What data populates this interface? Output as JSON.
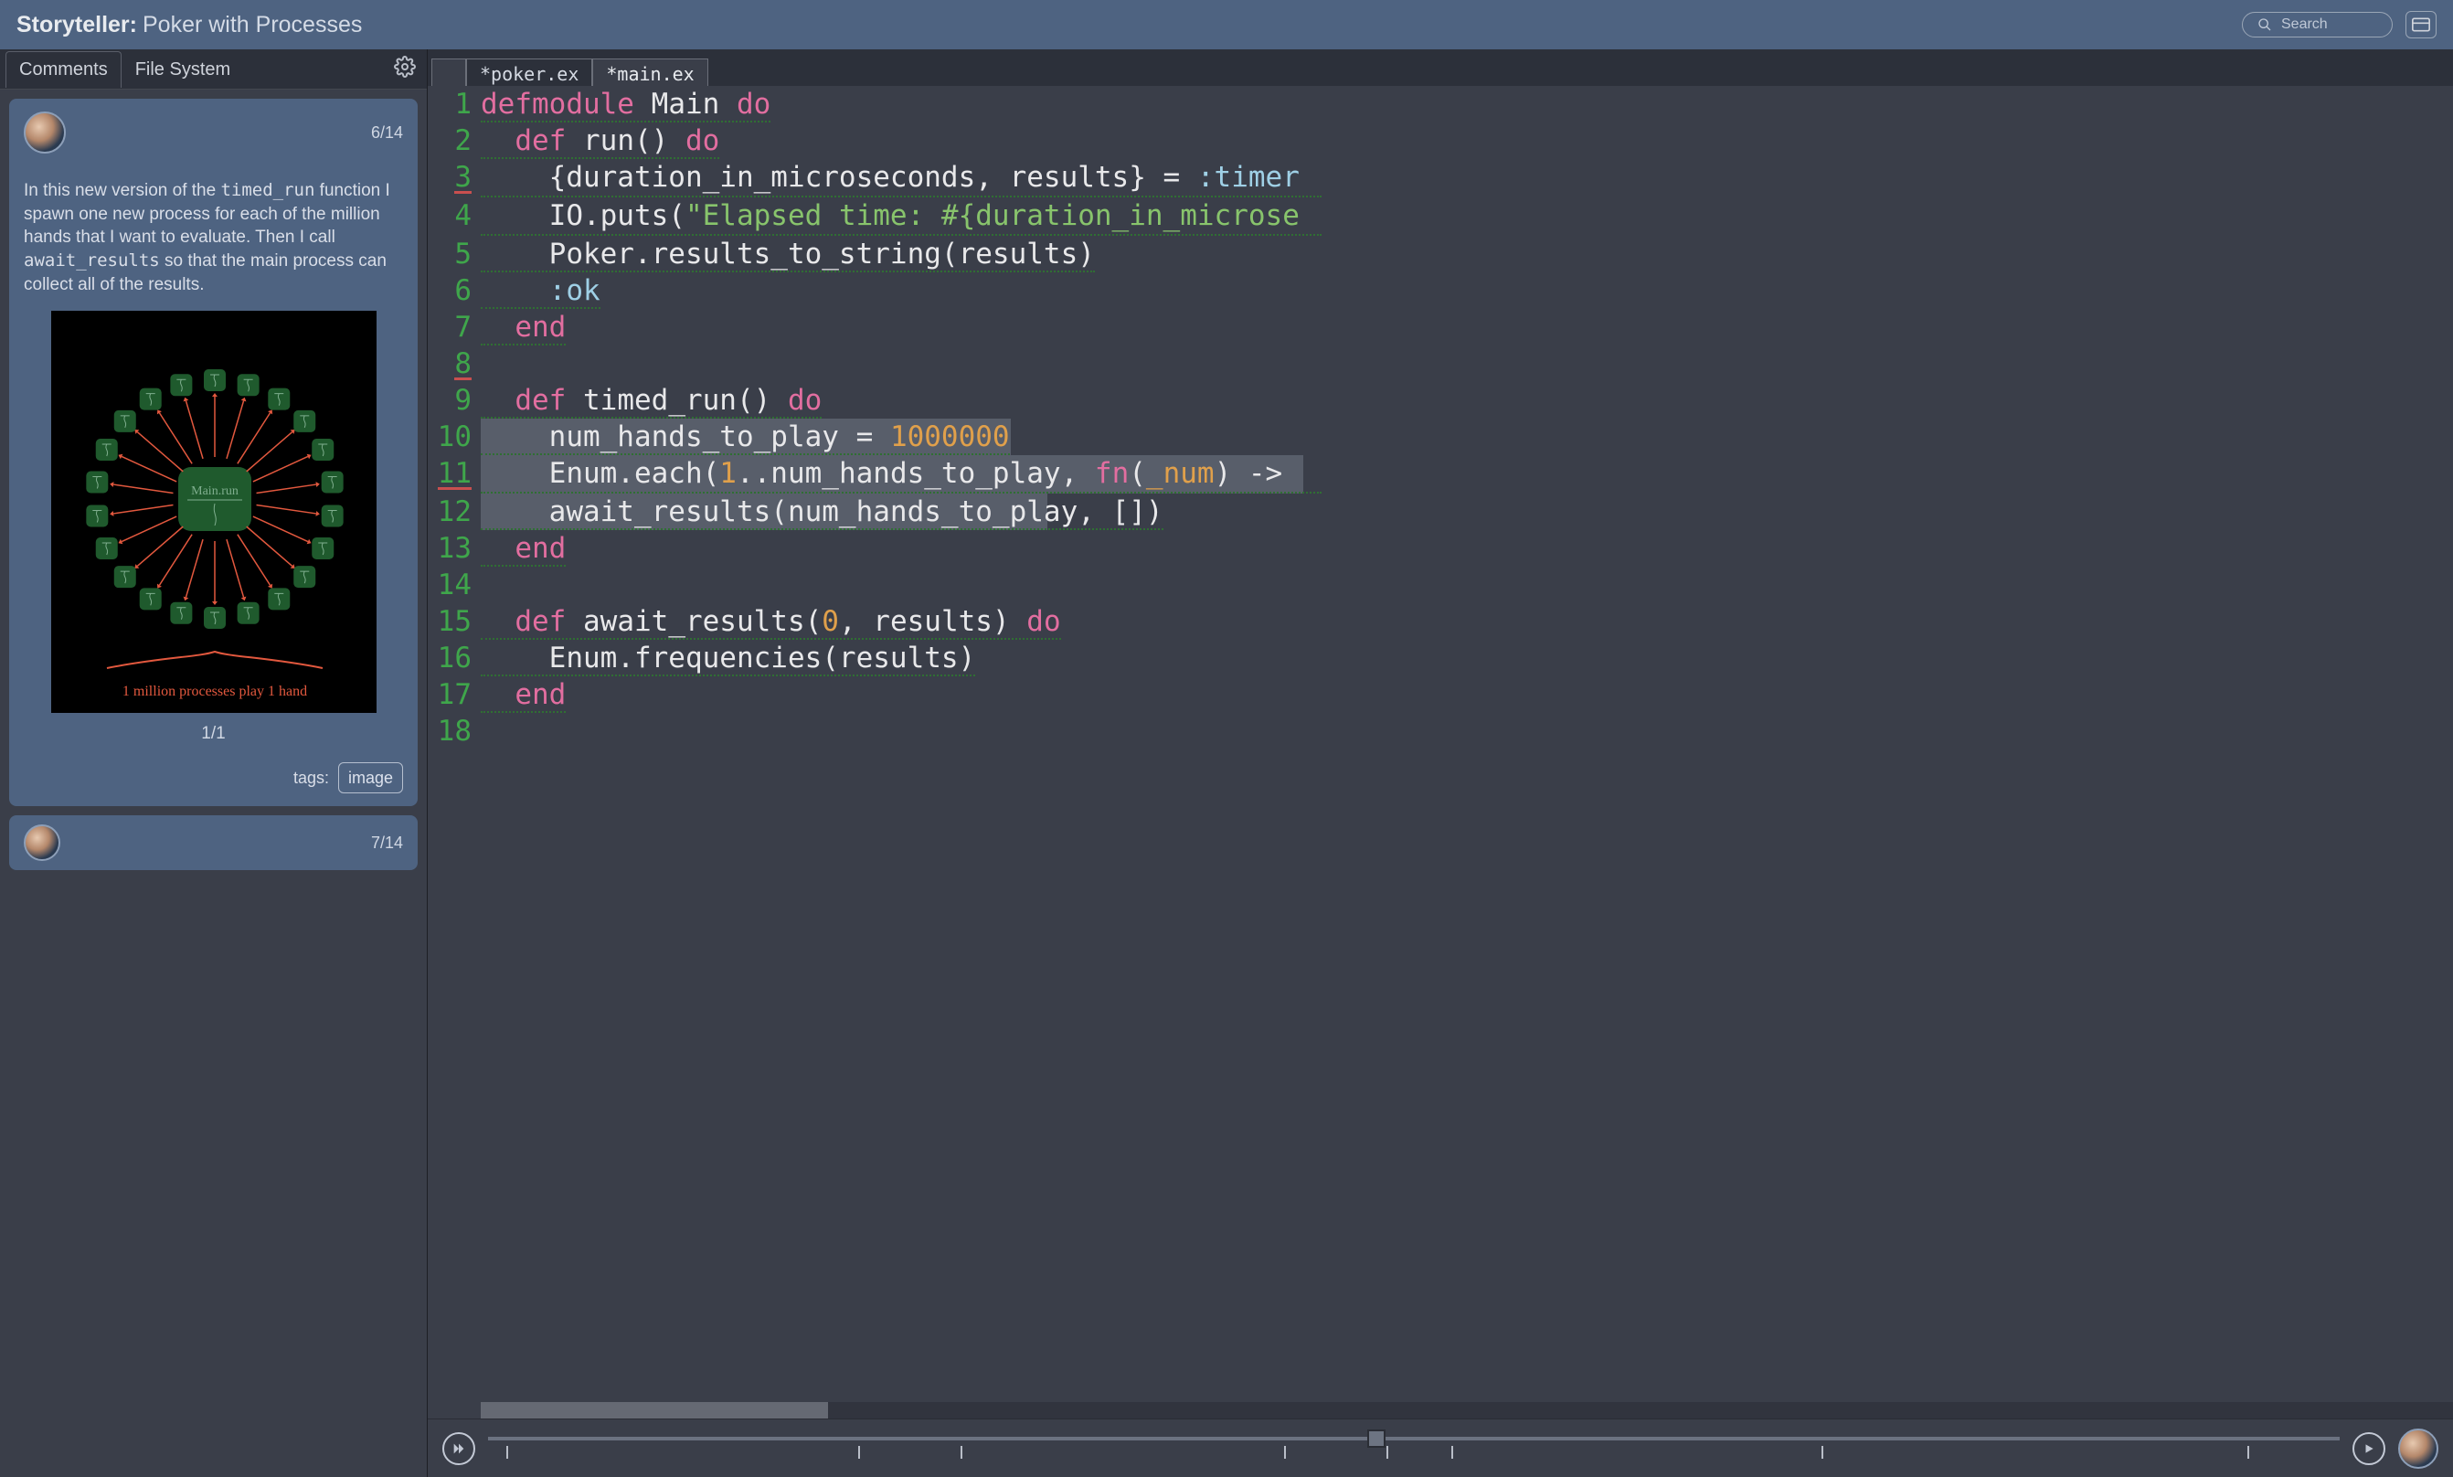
{
  "header": {
    "app_name": "Storyteller:",
    "project_title": "Poker with Processes",
    "search_placeholder": "Search"
  },
  "left_panel": {
    "tabs": {
      "comments": "Comments",
      "filesystem": "File System",
      "active": "comments"
    },
    "comment": {
      "counter": "6/14",
      "body_before_code1": "In this new version of the ",
      "code1": "timed_run",
      "body_mid": " function I spawn one new process for each of the million hands that I want to evaluate. Then I call ",
      "code2": "await_results",
      "body_after_code2": " so that the main process can collect all of the results.",
      "image_counter": "1/1",
      "tags_label": "tags:",
      "tag_value": "image",
      "diagram": {
        "center_label": "Main.run",
        "caption": "1 million processes play 1 hand"
      }
    },
    "next_comment_counter": "7/14"
  },
  "editor": {
    "tabs": [
      "*poker.ex",
      "*main.ex"
    ],
    "active_tab_index": 1,
    "lines": [
      {
        "n": 1,
        "err": false,
        "dots": true,
        "hl": 0,
        "html": "<span class='kw'>defmodule</span> <span class='nm'>Main</span> <span class='kw'>do</span>"
      },
      {
        "n": 2,
        "err": false,
        "dots": true,
        "hl": 0,
        "html": "  <span class='kw'>def</span> <span class='nm'>run()</span> <span class='kw'>do</span>"
      },
      {
        "n": 3,
        "err": true,
        "dots": true,
        "hl": 0,
        "html": "    <span class='nm'>{duration_in_microseconds, results} = </span><span class='atom'>:timer</span>"
      },
      {
        "n": 4,
        "err": false,
        "dots": true,
        "hl": 0,
        "html": "    <span class='nm'>IO.puts(</span><span class='str'>\"Elapsed time: #{duration_in_microse</span>"
      },
      {
        "n": 5,
        "err": false,
        "dots": true,
        "hl": 0,
        "html": "    <span class='nm'>Poker.results_to_string(results)</span>"
      },
      {
        "n": 6,
        "err": false,
        "dots": true,
        "hl": 0,
        "html": "    <span class='atom'>:ok</span>"
      },
      {
        "n": 7,
        "err": false,
        "dots": true,
        "hl": 0,
        "html": "  <span class='kw'>end</span>"
      },
      {
        "n": 8,
        "err": true,
        "dots": false,
        "hl": 0,
        "html": ""
      },
      {
        "n": 9,
        "err": false,
        "dots": true,
        "hl": 0,
        "html": "  <span class='kw'>def</span> <span class='nm'>timed_run()</span> <span class='kw'>do</span>"
      },
      {
        "n": 10,
        "err": false,
        "dots": true,
        "hl": 580,
        "html": "    <span class='nm'>num_hands_to_play = </span><span class='num'>1000000</span>"
      },
      {
        "n": 11,
        "err": true,
        "dots": true,
        "hl": 900,
        "html": "    <span class='nm'>Enum.each(</span><span class='num'>1</span><span class='nm'>..num_hands_to_play, </span><span class='kw'>fn</span><span class='nm'>(</span><span class='param'>_num</span><span class='nm'>) -&gt; </span>"
      },
      {
        "n": 12,
        "err": false,
        "dots": true,
        "hl": 620,
        "html": "    <span class='nm'>await_results(num_hands_to_play, [])</span>"
      },
      {
        "n": 13,
        "err": false,
        "dots": true,
        "hl": 0,
        "html": "  <span class='kw'>end</span>"
      },
      {
        "n": 14,
        "err": false,
        "dots": false,
        "hl": 0,
        "html": ""
      },
      {
        "n": 15,
        "err": false,
        "dots": true,
        "hl": 0,
        "html": "  <span class='kw'>def</span> <span class='nm'>await_results(</span><span class='num'>0</span><span class='nm'>, results)</span> <span class='kw'>do</span>"
      },
      {
        "n": 16,
        "err": false,
        "dots": true,
        "hl": 0,
        "html": "    <span class='nm'>Enum.frequencies(results)</span>"
      },
      {
        "n": 17,
        "err": false,
        "dots": true,
        "hl": 0,
        "html": "  <span class='kw'>end</span>"
      },
      {
        "n": 18,
        "err": false,
        "dots": false,
        "hl": 0,
        "html": ""
      }
    ]
  },
  "playback": {
    "handle_percent": 48,
    "tick_percents": [
      1,
      20,
      25.5,
      43,
      48.5,
      52,
      72,
      95
    ]
  }
}
